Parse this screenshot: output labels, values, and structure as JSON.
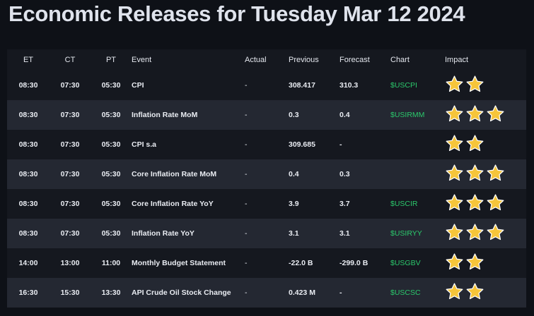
{
  "page": {
    "title": "Economic Releases for Tuesday Mar 12 2024"
  },
  "columns": {
    "et": "ET",
    "ct": "CT",
    "pt": "PT",
    "event": "Event",
    "actual": "Actual",
    "previous": "Previous",
    "forecast": "Forecast",
    "chart": "Chart",
    "impact": "Impact"
  },
  "rows": [
    {
      "et": "08:30",
      "ct": "07:30",
      "pt": "05:30",
      "event": "CPI",
      "actual": "-",
      "previous": "308.417",
      "forecast": "310.3",
      "chart": "$USCPI",
      "impact": 2
    },
    {
      "et": "08:30",
      "ct": "07:30",
      "pt": "05:30",
      "event": "Inflation Rate MoM",
      "actual": "-",
      "previous": "0.3",
      "forecast": "0.4",
      "chart": "$USIRMM",
      "impact": 3
    },
    {
      "et": "08:30",
      "ct": "07:30",
      "pt": "05:30",
      "event": "CPI s.a",
      "actual": "-",
      "previous": "309.685",
      "forecast": "-",
      "chart": "",
      "impact": 2
    },
    {
      "et": "08:30",
      "ct": "07:30",
      "pt": "05:30",
      "event": "Core Inflation Rate MoM",
      "actual": "-",
      "previous": "0.4",
      "forecast": "0.3",
      "chart": "",
      "impact": 3
    },
    {
      "et": "08:30",
      "ct": "07:30",
      "pt": "05:30",
      "event": "Core Inflation Rate YoY",
      "actual": "-",
      "previous": "3.9",
      "forecast": "3.7",
      "chart": "$USCIR",
      "impact": 3
    },
    {
      "et": "08:30",
      "ct": "07:30",
      "pt": "05:30",
      "event": "Inflation Rate YoY",
      "actual": "-",
      "previous": "3.1",
      "forecast": "3.1",
      "chart": "$USIRYY",
      "impact": 3
    },
    {
      "et": "14:00",
      "ct": "13:00",
      "pt": "11:00",
      "event": "Monthly Budget Statement",
      "actual": "-",
      "previous": "-22.0 B",
      "forecast": "-299.0 B",
      "chart": "$USGBV",
      "impact": 2
    },
    {
      "et": "16:30",
      "ct": "15:30",
      "pt": "13:30",
      "event": "API Crude Oil Stock Change",
      "actual": "-",
      "previous": "0.423 M",
      "forecast": "-",
      "chart": "$USCSC",
      "impact": 2
    }
  ],
  "colors": {
    "background": "#0e1117",
    "row_dark": "#15181f",
    "row_light": "#242832",
    "text": "#e9ecf2",
    "chart_link": "#2bc96c",
    "star_fill": "#f6c53a",
    "star_stroke": "#ffffff"
  },
  "icons": {
    "impact": "star-icon"
  }
}
